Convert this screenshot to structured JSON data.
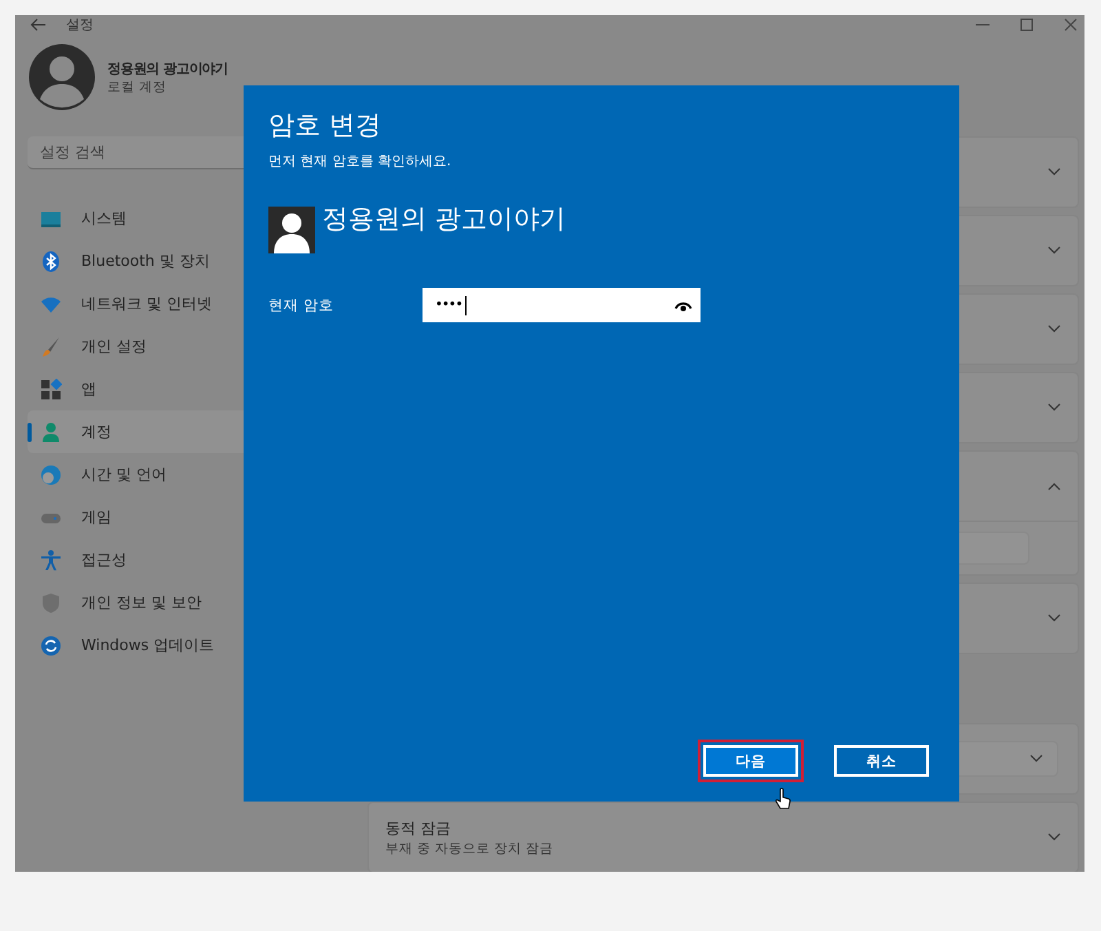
{
  "window": {
    "title": "설정"
  },
  "account": {
    "name": "정용원의 광고이야기",
    "type": "로컬 계정"
  },
  "search": {
    "placeholder": "설정 검색"
  },
  "nav": [
    {
      "label": "시스템",
      "selected": false
    },
    {
      "label": "Bluetooth 및 장치",
      "selected": false
    },
    {
      "label": "네트워크 및 인터넷",
      "selected": false
    },
    {
      "label": "개인 설정",
      "selected": false
    },
    {
      "label": "앱",
      "selected": false
    },
    {
      "label": "계정",
      "selected": true
    },
    {
      "label": "시간 및 언어",
      "selected": false
    },
    {
      "label": "게임",
      "selected": false
    },
    {
      "label": "접근성",
      "selected": false
    },
    {
      "label": "개인 정보 및 보안",
      "selected": false
    },
    {
      "label": "Windows 업데이트",
      "selected": false
    }
  ],
  "cards": [
    {
      "kind": "plain",
      "expanded": false
    },
    {
      "kind": "plain",
      "expanded": false
    },
    {
      "kind": "plain",
      "expanded": false
    },
    {
      "kind": "plain",
      "expanded": false
    },
    {
      "kind": "plain",
      "expanded": true
    },
    {
      "kind": "plain",
      "expanded": false
    },
    {
      "kind": "dropdown",
      "expanded": false
    },
    {
      "kind": "plain",
      "expanded": false,
      "title": "동적 잠금",
      "subtitle": "부재 중 자동으로 장치 잠금"
    }
  ],
  "dialog": {
    "title": "암호 변경",
    "instruction": "먼저 현재 암호를 확인하세요.",
    "user": "정용원의 광고이야기",
    "field": {
      "label": "현재 암호",
      "value": "••••"
    },
    "buttons": [
      {
        "label": "다음",
        "highlighted": true
      },
      {
        "label": "취소",
        "highlighted": false
      }
    ]
  }
}
